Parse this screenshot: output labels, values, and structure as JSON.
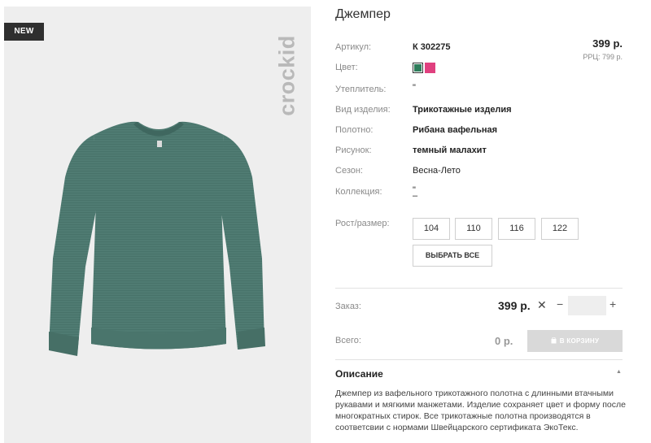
{
  "product": {
    "badge": "NEW",
    "brand": "crockid",
    "title": "Джемпер"
  },
  "specs": [
    {
      "label": "Артикул:",
      "value": "К 302275"
    },
    {
      "label": "Цвет:",
      "value": ""
    },
    {
      "label": "Утеплитель:",
      "value": "\""
    },
    {
      "label": "Вид изделия:",
      "value": "Трикотажные изделия"
    },
    {
      "label": "Полотно:",
      "value": "Рибана вафельная"
    },
    {
      "label": "Рисунок:",
      "value": "темный малахит"
    },
    {
      "label": "Сезон:",
      "value": "Весна-Лето"
    },
    {
      "label": "Коллекция:",
      "value": "\""
    }
  ],
  "price": {
    "value": "399 р.",
    "rrp": "РРЦ: 799 р."
  },
  "colors": {
    "selected": "#2e7d5b",
    "other": "#e0407f"
  },
  "sizes": {
    "label": "Рост/размер:",
    "options": [
      "104",
      "110",
      "116",
      "122"
    ],
    "select_all": "ВЫБРАТЬ ВСЕ"
  },
  "order": {
    "label": "Заказ:",
    "price": "399 р.",
    "quantity": ""
  },
  "total": {
    "label": "Всего:",
    "value": "0 р.",
    "cart_button": "В КОРЗИНУ"
  },
  "description": {
    "title": "Описание",
    "text": "Джемпер из вафельного трикотажного полотна с длинными втачными рукавами и мягкими манжетами. Изделие сохраняет цвет и форму после многократных стирок. Все трикотажные полотна производятся в соответсвии с нормами Швейцарского сертификата ЭкоТекс."
  }
}
